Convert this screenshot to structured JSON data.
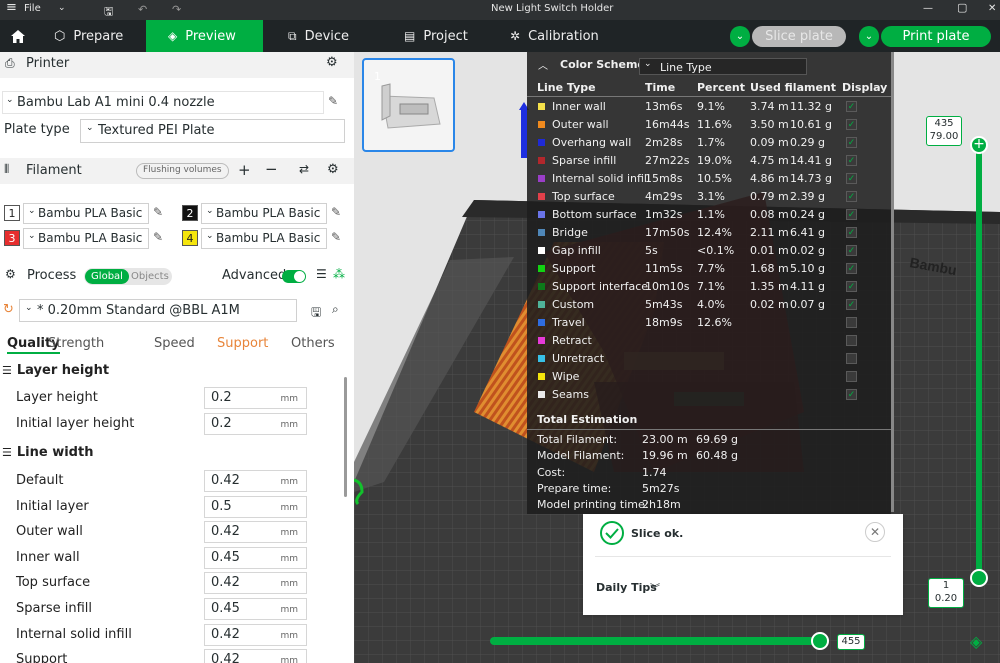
{
  "titlebar": {
    "file": "File",
    "title": "New Light Switch Holder"
  },
  "tabs": {
    "prepare": "Prepare",
    "preview": "Preview",
    "device": "Device",
    "project": "Project",
    "calibration": "Calibration"
  },
  "actions": {
    "slice": "Slice plate",
    "print": "Print plate"
  },
  "printer": {
    "header": "Printer",
    "name": "Bambu Lab A1 mini 0.4 nozzle",
    "plate_label": "Plate type",
    "plate_value": "Textured PEI Plate"
  },
  "filament": {
    "header": "Filament",
    "flushing": "Flushing volumes",
    "slots": [
      {
        "num": "1",
        "name": "Bambu PLA Basic",
        "color": "#ffffff",
        "fg": "#222222"
      },
      {
        "num": "2",
        "name": "Bambu PLA Basic",
        "color": "#111111",
        "fg": "#ffffff"
      },
      {
        "num": "3",
        "name": "Bambu PLA Basic",
        "color": "#e62e2e",
        "fg": "#ffffff"
      },
      {
        "num": "4",
        "name": "Bambu PLA Basic",
        "color": "#f5e50c",
        "fg": "#222222"
      }
    ]
  },
  "process": {
    "header": "Process",
    "global": "Global",
    "objects": "Objects",
    "advanced": "Advanced",
    "preset": "* 0.20mm Standard @BBL A1M",
    "tabs": [
      "Quality",
      "Strength",
      "Speed",
      "Support",
      "Others"
    ],
    "layer_height": {
      "title": "Layer height",
      "rows": [
        {
          "label": "Layer height",
          "value": "0.2",
          "unit": "mm"
        },
        {
          "label": "Initial layer height",
          "value": "0.2",
          "unit": "mm"
        }
      ]
    },
    "line_width": {
      "title": "Line width",
      "rows": [
        {
          "label": "Default",
          "value": "0.42",
          "unit": "mm"
        },
        {
          "label": "Initial layer",
          "value": "0.5",
          "unit": "mm"
        },
        {
          "label": "Outer wall",
          "value": "0.42",
          "unit": "mm"
        },
        {
          "label": "Inner wall",
          "value": "0.45",
          "unit": "mm"
        },
        {
          "label": "Top surface",
          "value": "0.42",
          "unit": "mm"
        },
        {
          "label": "Sparse infill",
          "value": "0.45",
          "unit": "mm"
        },
        {
          "label": "Internal solid infill",
          "value": "0.42",
          "unit": "mm"
        },
        {
          "label": "Support",
          "value": "0.42",
          "unit": "mm"
        }
      ]
    }
  },
  "thumbnail": {
    "index": "1"
  },
  "legend": {
    "title": "Color Scheme",
    "scheme": "Line Type",
    "headers": {
      "type": "Line Type",
      "time": "Time",
      "percent": "Percent",
      "used": "Used filament",
      "display": "Display"
    },
    "rows": [
      {
        "name": "Inner wall",
        "color": "#f5e14a",
        "time": "13m6s",
        "percent": "9.1%",
        "len": "3.74 m",
        "weight": "11.32 g",
        "on": true
      },
      {
        "name": "Outer wall",
        "color": "#f08a1e",
        "time": "16m44s",
        "percent": "11.6%",
        "len": "3.50 m",
        "weight": "10.61 g",
        "on": true
      },
      {
        "name": "Overhang wall",
        "color": "#1f2ad6",
        "time": "2m28s",
        "percent": "1.7%",
        "len": "0.09 m",
        "weight": "0.29 g",
        "on": true
      },
      {
        "name": "Sparse infill",
        "color": "#b2272c",
        "time": "27m22s",
        "percent": "19.0%",
        "len": "4.75 m",
        "weight": "14.41 g",
        "on": true
      },
      {
        "name": "Internal solid infill",
        "color": "#9a3ec8",
        "time": "15m8s",
        "percent": "10.5%",
        "len": "4.86 m",
        "weight": "14.73 g",
        "on": true
      },
      {
        "name": "Top surface",
        "color": "#e2404a",
        "time": "4m29s",
        "percent": "3.1%",
        "len": "0.79 m",
        "weight": "2.39 g",
        "on": true
      },
      {
        "name": "Bottom surface",
        "color": "#6a74e8",
        "time": "1m32s",
        "percent": "1.1%",
        "len": "0.08 m",
        "weight": "0.24 g",
        "on": true
      },
      {
        "name": "Bridge",
        "color": "#4f87b8",
        "time": "17m50s",
        "percent": "12.4%",
        "len": "2.11 m",
        "weight": "6.41 g",
        "on": true
      },
      {
        "name": "Gap infill",
        "color": "#ffffff",
        "time": "5s",
        "percent": "<0.1%",
        "len": "0.01 m",
        "weight": "0.02 g",
        "on": true
      },
      {
        "name": "Support",
        "color": "#12d312",
        "time": "11m5s",
        "percent": "7.7%",
        "len": "1.68 m",
        "weight": "5.10 g",
        "on": true
      },
      {
        "name": "Support interface",
        "color": "#0c7a1a",
        "time": "10m10s",
        "percent": "7.1%",
        "len": "1.35 m",
        "weight": "4.11 g",
        "on": true
      },
      {
        "name": "Custom",
        "color": "#4fb39a",
        "time": "5m43s",
        "percent": "4.0%",
        "len": "0.02 m",
        "weight": "0.07 g",
        "on": true
      },
      {
        "name": "Travel",
        "color": "#2f6de0",
        "time": "18m9s",
        "percent": "12.6%",
        "len": "",
        "weight": "",
        "on": false
      },
      {
        "name": "Retract",
        "color": "#e63ad8",
        "time": "",
        "percent": "",
        "len": "",
        "weight": "",
        "on": false
      },
      {
        "name": "Unretract",
        "color": "#38c0e6",
        "time": "",
        "percent": "",
        "len": "",
        "weight": "",
        "on": false
      },
      {
        "name": "Wipe",
        "color": "#f5e50c",
        "time": "",
        "percent": "",
        "len": "",
        "weight": "",
        "on": false
      },
      {
        "name": "Seams",
        "color": "#eaeaea",
        "time": "",
        "percent": "",
        "len": "",
        "weight": "",
        "on": true
      }
    ],
    "total_title": "Total Estimation",
    "totals": [
      {
        "label": "Total Filament:",
        "v1": "23.00 m",
        "v2": "69.69 g"
      },
      {
        "label": "Model Filament:",
        "v1": "19.96 m",
        "v2": "60.48 g"
      },
      {
        "label": "Cost:",
        "v1": "1.74",
        "v2": ""
      },
      {
        "label": "Prepare time:",
        "v1": "5m27s",
        "v2": ""
      },
      {
        "label": "Model printing time:",
        "v1": "2h18m",
        "v2": ""
      }
    ]
  },
  "slice_popup": {
    "status": "Slice ok.",
    "tips": "Daily Tips"
  },
  "vslider": {
    "top_layer": "435",
    "top_height": "79.00",
    "bottom_layer": "1",
    "bottom_height": "0.20"
  },
  "hslider": {
    "value": "455"
  },
  "bed_brand": "Bambu",
  "colors": {
    "accent": "#00ae42",
    "support_tab": "#e8853a"
  }
}
